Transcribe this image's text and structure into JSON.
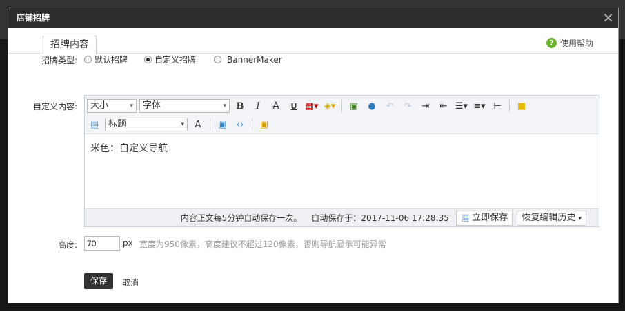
{
  "dialog": {
    "title": "店铺招牌",
    "close": "✕"
  },
  "tab": "招牌内容",
  "help": "使用帮助",
  "form": {
    "type_label": "招牌类型:",
    "types": [
      {
        "label": "默认招牌",
        "checked": false
      },
      {
        "label": "自定义招牌",
        "checked": true
      },
      {
        "label": "BannerMaker",
        "checked": false
      }
    ],
    "content_label": "自定义内容:",
    "height_label": "高度:",
    "height_value": "70",
    "height_unit": "px",
    "height_hint": "宽度为950像素，高度建议不超过120像素，否则导航显示可能异常"
  },
  "editor": {
    "size_select": "大小",
    "font_select": "字体",
    "heading_select": "标题",
    "content": "米色：自定义导航",
    "autosave_note": "内容正文每5分钟自动保存一次。",
    "autosave_time": "自动保存于：2017-11-06 17:28:35",
    "save_now": "立即保存",
    "restore_history": "恢复编辑历史"
  },
  "actions": {
    "save": "保存",
    "cancel": "取消"
  }
}
